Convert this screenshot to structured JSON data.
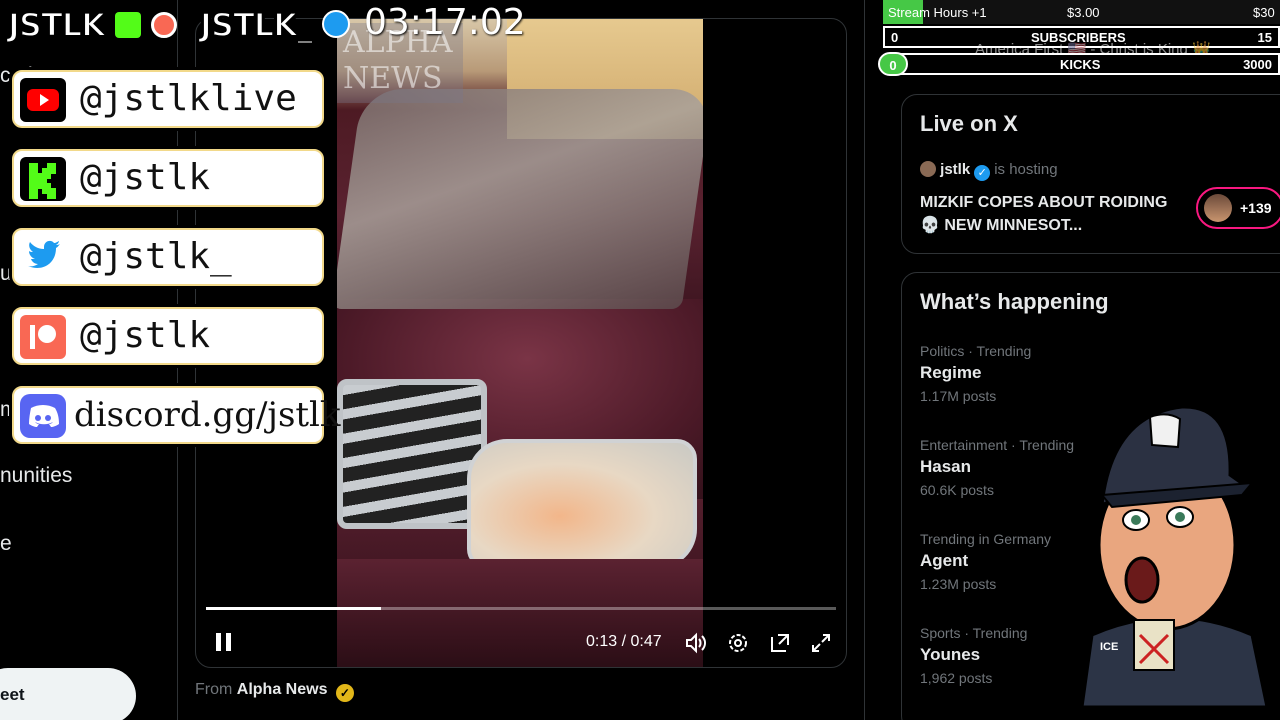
{
  "leftnav": {
    "fragments": [
      "cati",
      "u",
      "m",
      "nunities",
      "e"
    ],
    "post_button": "eet"
  },
  "stream_overlay": {
    "brand_left": "JSTLK",
    "brand_right": "JSTLK_",
    "clock": "03:17:02",
    "socials": [
      {
        "label": "@jstlklive",
        "icon": "youtube-icon",
        "color": "#ff0000"
      },
      {
        "label": "@jstlk",
        "icon": "kick-icon",
        "color": "#53fc18"
      },
      {
        "label": "@jstlk_",
        "icon": "twitter-icon",
        "color": "#1d9bf0"
      },
      {
        "label": "@jstlk",
        "icon": "patreon-icon",
        "color": "#f96854"
      },
      {
        "label": "discord.gg/jstlk",
        "icon": "discord-icon",
        "color": "#5865f2"
      }
    ],
    "stream_hours": {
      "label": "Stream Hours +1",
      "price": "$3.00",
      "goal": "$30",
      "progress": 0.1
    },
    "subscribers": {
      "left": "0",
      "label": "SUBSCRIBERS",
      "right": "15"
    },
    "ticker": "America First 🇺🇸 - Christ is King 👑",
    "kicks": {
      "left": "0",
      "label": "KICKS",
      "right": "3000"
    }
  },
  "video": {
    "watermark": "ALPHA NEWS",
    "current_time": "0:13",
    "duration": "0:47",
    "time_display": "0:13 / 0:47",
    "progress": 0.277,
    "source_prefix": "From",
    "source_name": "Alpha News"
  },
  "live_on_x": {
    "title": "Live on X",
    "host": "jstlk",
    "host_suffix": "is hosting",
    "stream_title": "MIZKIF COPES ABOUT ROIDING 💀 NEW MINNESOT...",
    "listener_count": "+139"
  },
  "whats_happening": {
    "title": "What’s happening",
    "trends": [
      {
        "category": "Politics · Trending",
        "name": "Regime",
        "count": "1.17M posts"
      },
      {
        "category": "Entertainment · Trending",
        "name": "Hasan",
        "count": "60.6K posts"
      },
      {
        "category": "Trending in Germany",
        "name": "Agent",
        "count": "1.23M posts"
      },
      {
        "category": "Sports · Trending",
        "name": "Younes",
        "count": "1,962 posts"
      }
    ]
  },
  "mascot": {
    "cap_text": "ICE"
  },
  "colors": {
    "accent_blue": "#1d9bf0",
    "live_pink": "#f91880",
    "kick_green": "#46c846",
    "gold": "#e2b719"
  }
}
